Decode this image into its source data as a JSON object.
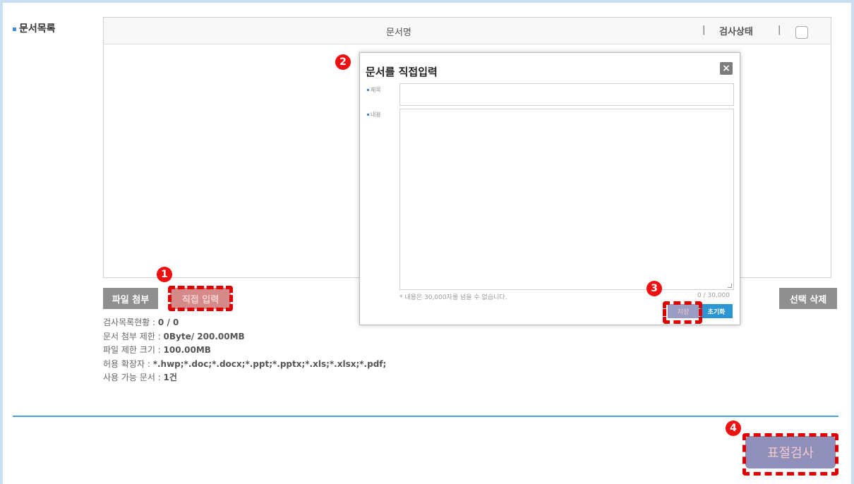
{
  "section": {
    "label": "문서목록"
  },
  "table": {
    "col_name": "문서명",
    "col_status": "검사상태",
    "separator": "|"
  },
  "buttons": {
    "attach": "파일 첨부",
    "direct_input": "직접 입력",
    "delete_selected": "선택 삭제",
    "submit": "표절검사"
  },
  "info": {
    "list_status_label": "검사목록현황 : ",
    "list_status_value": "0 / 0",
    "attach_limit_label": "문서 첨부 제한 : ",
    "attach_limit_value": "0Byte/ 200.00MB",
    "file_size_label": "파일 제한 크기 : ",
    "file_size_value": "100.00MB",
    "extensions_label": "허용 확장자 : ",
    "extensions_value": "*.hwp;*.doc;*.docx;*.ppt;*.pptx;*.xls;*.xlsx;*.pdf;",
    "available_label": "사용 가능 문서 : ",
    "available_value": "1건"
  },
  "modal": {
    "title": "문서를 직접입력",
    "close": "×",
    "title_label": "제목",
    "content_label": "내용",
    "title_value": "",
    "content_value": "",
    "hint": "* 내용은 30,000자를 넘을 수 없습니다.",
    "counter": "0 / 30,000",
    "save": "저장",
    "reset": "초기화"
  },
  "badges": [
    "1",
    "2",
    "3",
    "4"
  ],
  "colors": {
    "accent_blue": "#2b96d3",
    "annotation_red": "#e00000",
    "submit_bg": "#8e90b9",
    "gray_button": "#8f8f8f"
  }
}
